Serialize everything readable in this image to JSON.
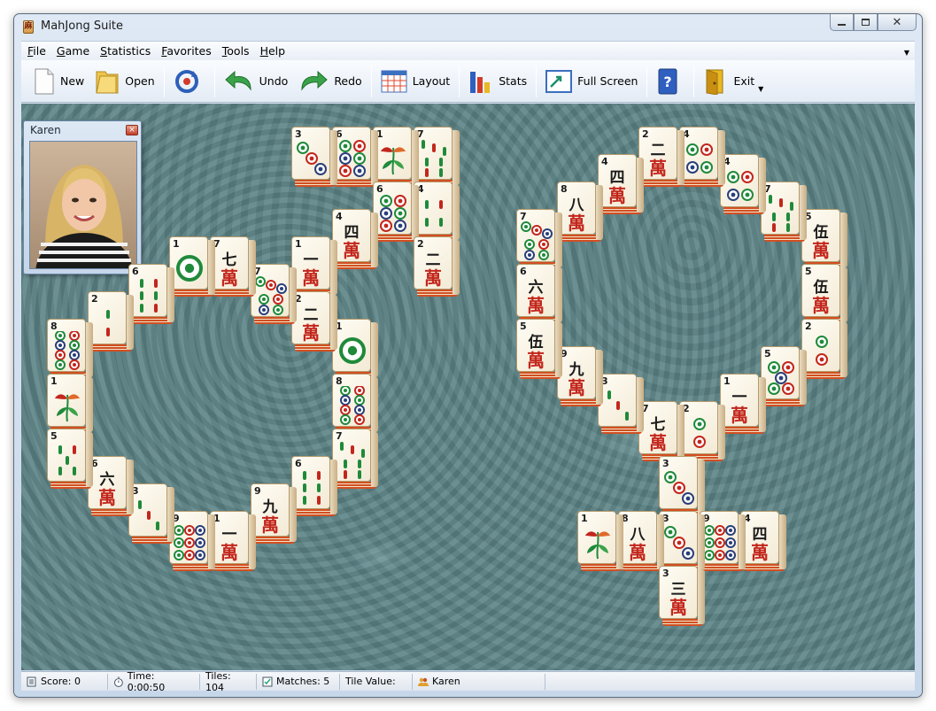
{
  "window": {
    "title": "MahJong Suite"
  },
  "menu": [
    {
      "label": "File",
      "acc": "F",
      "rest": "ile"
    },
    {
      "label": "Game",
      "acc": "G",
      "rest": "ame"
    },
    {
      "label": "Statistics",
      "acc": "S",
      "rest": "tatistics"
    },
    {
      "label": "Favorites",
      "acc": "F",
      "rest": "avorites"
    },
    {
      "label": "Tools",
      "acc": "T",
      "rest": "ools"
    },
    {
      "label": "Help",
      "acc": "H",
      "rest": "elp"
    }
  ],
  "toolbar": {
    "new": "New",
    "open": "Open",
    "undo": "Undo",
    "redo": "Redo",
    "layout": "Layout",
    "stats": "Stats",
    "fullscreen": "Full Screen",
    "exit": "Exit"
  },
  "player": {
    "name": "Karen"
  },
  "status": {
    "score": "Score: 0",
    "time": "Time: 0:00:50",
    "tiles": "Tiles: 104",
    "matches": "Matches: 5",
    "tile_value": "Tile Value:",
    "player": "Karen"
  },
  "colors": {
    "board": "#5b8285",
    "tile_face": "#fffdf5",
    "tile_edge": "#d24f22",
    "char_red": "#c3261c"
  },
  "tiles": [
    {
      "num": "3",
      "suit": "dots",
      "n": 3
    },
    {
      "num": "6",
      "suit": "dots",
      "n": 6
    },
    {
      "num": "1",
      "suit": "flower"
    },
    {
      "num": "7",
      "suit": "bamboo",
      "n": 7
    },
    {
      "num": "6",
      "suit": "dots",
      "n": 6
    },
    {
      "num": "4",
      "suit": "bamboo",
      "n": 4
    },
    {
      "num": "4",
      "suit": "char",
      "c": "四"
    },
    {
      "num": "2",
      "suit": "char",
      "c": "二"
    },
    {
      "num": "1",
      "suit": "dots",
      "n": 1
    },
    {
      "num": "7",
      "suit": "char",
      "c": "七"
    },
    {
      "num": "1",
      "suit": "char",
      "c": "一"
    },
    {
      "num": "6",
      "suit": "bamboo",
      "n": 6
    },
    {
      "num": "7",
      "suit": "dots",
      "n": 7
    },
    {
      "num": "2",
      "suit": "bamboo",
      "n": 2
    },
    {
      "num": "2",
      "suit": "char",
      "c": "二"
    },
    {
      "num": "8",
      "suit": "dots",
      "n": 8
    },
    {
      "num": "1",
      "suit": "dots",
      "n": 1
    },
    {
      "num": "1",
      "suit": "flower"
    },
    {
      "num": "8",
      "suit": "dots",
      "n": 8
    },
    {
      "num": "5",
      "suit": "bamboo",
      "n": 5
    },
    {
      "num": "7",
      "suit": "bamboo",
      "n": 7
    },
    {
      "num": "6",
      "suit": "char",
      "c": "六"
    },
    {
      "num": "6",
      "suit": "bamboo",
      "n": 6
    },
    {
      "num": "3",
      "suit": "bamboo",
      "n": 3
    },
    {
      "num": "9",
      "suit": "char",
      "c": "九"
    },
    {
      "num": "9",
      "suit": "dots",
      "n": 9
    },
    {
      "num": "1",
      "suit": "char",
      "c": "一"
    },
    {
      "num": "2",
      "suit": "char",
      "c": "二"
    },
    {
      "num": "4",
      "suit": "dots",
      "n": 4
    },
    {
      "num": "4",
      "suit": "char",
      "c": "四"
    },
    {
      "num": "4",
      "suit": "dots",
      "n": 4
    },
    {
      "num": "8",
      "suit": "char",
      "c": "八"
    },
    {
      "num": "7",
      "suit": "bamboo",
      "n": 7
    },
    {
      "num": "7",
      "suit": "dots",
      "n": 7
    },
    {
      "num": "5",
      "suit": "char",
      "c": "伍"
    },
    {
      "num": "6",
      "suit": "char",
      "c": "六"
    },
    {
      "num": "5",
      "suit": "char",
      "c": "伍"
    },
    {
      "num": "5",
      "suit": "char",
      "c": "伍"
    },
    {
      "num": "2",
      "suit": "dots",
      "n": 2
    },
    {
      "num": "9",
      "suit": "char",
      "c": "九"
    },
    {
      "num": "5",
      "suit": "dots",
      "n": 5
    },
    {
      "num": "3",
      "suit": "bamboo",
      "n": 3
    },
    {
      "num": "1",
      "suit": "char",
      "c": "一"
    },
    {
      "num": "7",
      "suit": "char",
      "c": "七"
    },
    {
      "num": "2",
      "suit": "dots",
      "n": 2
    },
    {
      "num": "3",
      "suit": "dots",
      "n": 3
    },
    {
      "num": "1",
      "suit": "flower"
    },
    {
      "num": "8",
      "suit": "char",
      "c": "八"
    },
    {
      "num": "3",
      "suit": "dots",
      "n": 3
    },
    {
      "num": "9",
      "suit": "dots",
      "n": 9
    },
    {
      "num": "4",
      "suit": "char",
      "c": "四"
    },
    {
      "num": "3",
      "suit": "char",
      "c": "三"
    }
  ]
}
